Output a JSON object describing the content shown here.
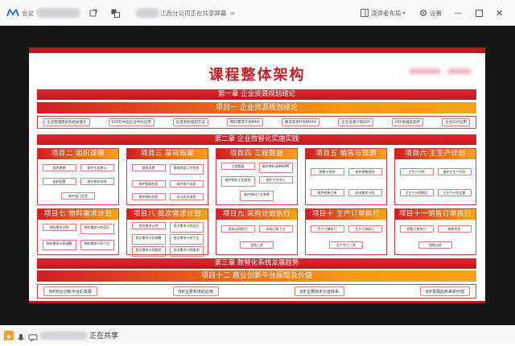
{
  "topbar": {
    "app_label": "会议",
    "share_title": "江西分公司正在共享屏幕",
    "presenter_layout": "演讲者布局",
    "settings": "设置"
  },
  "slide": {
    "title": "课程整体架构",
    "chapter1": "第一章 企业资源规划绪论",
    "proj1": "项目一 企业资源规划绪论",
    "row1_pills": [
      "企业管理模式及相关理论",
      "ERP在中国企业中的应用",
      "信息系统规划方法",
      "物料需求计划MRP",
      "制造资源计划MRPII",
      "企业资源计划ERP",
      "ERP发展及趋势",
      "企业ERP应用"
    ],
    "chapter2": "第二章 企业数智化实施实践",
    "projects_top": [
      {
        "title": "项目二 组织建模",
        "chips": [
          "组织建模",
          "维护业务单元",
          "组织配置",
          "维护组织权限",
          "维护部门信息"
        ]
      },
      {
        "title": "项目三 基础档案",
        "chips": [
          "基础设置",
          "基础档案公共信息",
          "维护基础档案",
          "维护客户档案",
          "维护物料档案",
          "设计业务流程"
        ]
      },
      {
        "title": "项目四 工程数据",
        "chips": [
          "工程数据",
          "维护物料清单BOM",
          "维护物料工艺路线",
          "维护工作中心",
          "维护物料工艺参数"
        ]
      },
      {
        "title": "项目五 销售与预测",
        "chips": [
          "销售与预测",
          "维护销售预测",
          "维护销售订单",
          "查询需求计划"
        ]
      },
      {
        "title": "项目六 主生产计划",
        "chips": [
          "主生产计划",
          "维护主生产计划",
          "主生产计划制定",
          "主生产计划运算"
        ]
      }
    ],
    "projects_bottom": [
      {
        "title": "项目七 物料需求计划",
        "chips": [
          "物料需求计划",
          "物料需求计划运行",
          "物料需求计划调整",
          "物料需求计划下达"
        ]
      },
      {
        "title": "项目八 批次需求计划",
        "chips": [
          "批次需求计划",
          "批次需求计划运行",
          "批次需求计划调整",
          "批次需求计划下达",
          "批次需求计划跟踪",
          "批次需求计划查询"
        ]
      },
      {
        "title": "项目九 采购计划执行",
        "chips": [
          "采购计划执行",
          "采购订单下达",
          "采购入库"
        ]
      },
      {
        "title": "项目十 生产订单执行",
        "chips": [
          "生产订单执行",
          "生产订单制订",
          "生产完工入库"
        ]
      },
      {
        "title": "项目十一销售订单执行",
        "chips": [
          "销售订单执行",
          "销售发货",
          "销售出库"
        ]
      }
    ],
    "chapter3": "第三章 数智化系统发展趋势",
    "proj12": "项目十二 商业创新平台原理及价值",
    "row12_pills": [
      "BIP商业创新平台的发展",
      "BIP主要系统的应用",
      "BIP主要技术价值体系",
      "BIP发展的未来和价值"
    ]
  },
  "bottombar": {
    "share_status": "正在共享"
  }
}
